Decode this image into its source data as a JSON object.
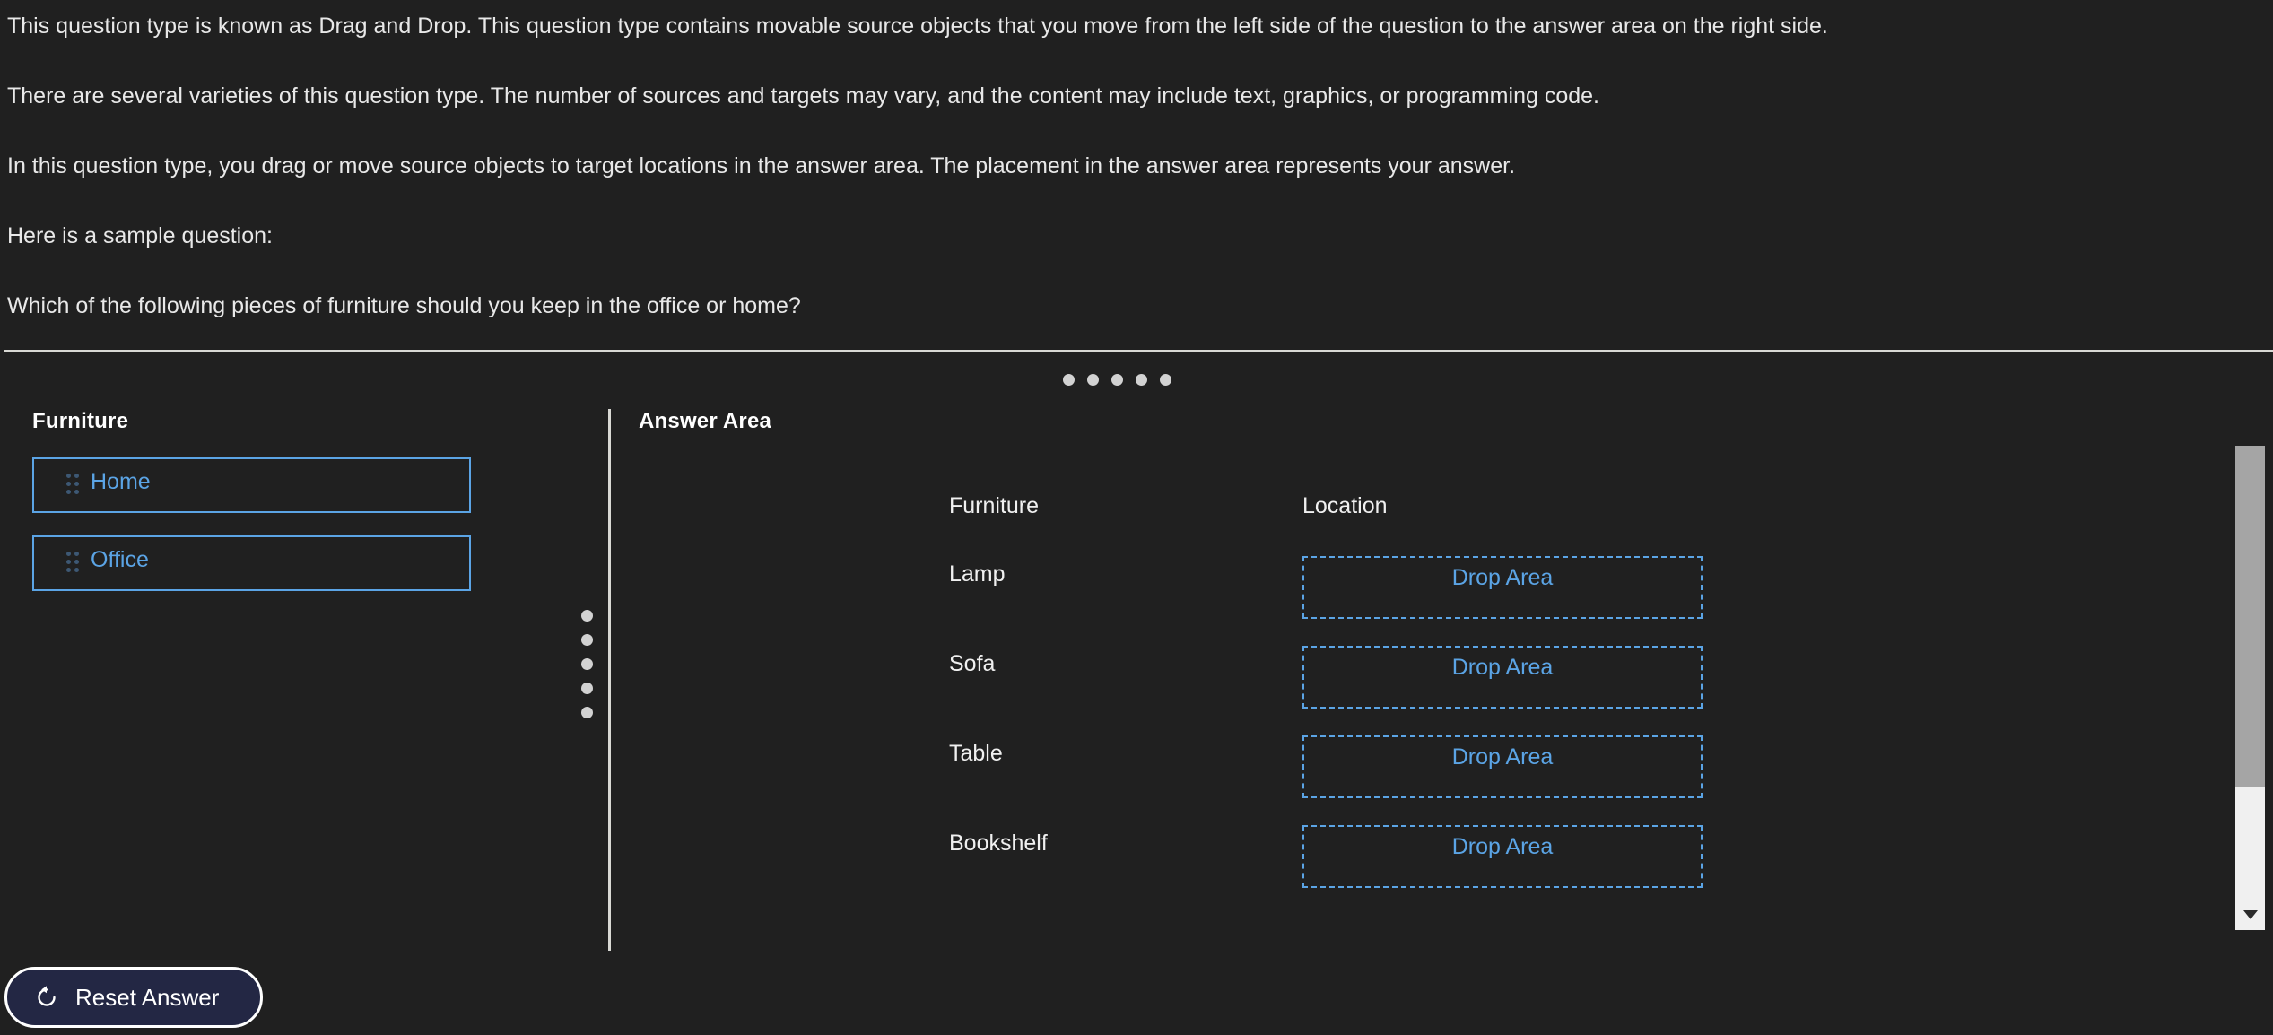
{
  "intro": {
    "paragraphs": [
      "This question type is known as Drag and Drop. This question type contains movable source objects that you move from the left side of the question to the answer area on the right side.",
      "There are several varieties of this question type. The number of sources and targets may vary, and the content may include text, graphics, or programming code.",
      "In this question type, you drag or move source objects to target locations in the answer area. The placement in the answer area represents your answer.",
      "Here is a sample question:",
      "Which of the following pieces of furniture should you keep in the office or home?"
    ]
  },
  "source_panel": {
    "title": "Furniture",
    "items": [
      {
        "label": "Home",
        "icon": "drag-handle-icon"
      },
      {
        "label": "Office",
        "icon": "drag-handle-icon"
      }
    ]
  },
  "answer_area": {
    "title": "Answer Area",
    "columns": {
      "furniture": "Furniture",
      "location": "Location"
    },
    "rows": [
      {
        "furniture": "Lamp",
        "location_placeholder": "Drop Area"
      },
      {
        "furniture": "Sofa",
        "location_placeholder": "Drop Area"
      },
      {
        "furniture": "Table",
        "location_placeholder": "Drop Area"
      },
      {
        "furniture": "Bookshelf",
        "location_placeholder": "Drop Area"
      }
    ]
  },
  "reset_button": {
    "label": "Reset Answer",
    "icon": "reset-arrow-icon"
  },
  "splitters": {
    "horizontal_grip_dots": 5,
    "vertical_grip_dots": 5
  },
  "scrollbar": {
    "arrow_down_icon": "chevron-down-icon"
  },
  "colors": {
    "background": "#202020",
    "accent_blue": "#5ba4e5",
    "divider": "#d9d9d4",
    "text": "#f0f0f0",
    "reset_fill": "#232744",
    "scroll_thumb": "#a5a5a5",
    "scroll_track": "#f0f0f0"
  }
}
